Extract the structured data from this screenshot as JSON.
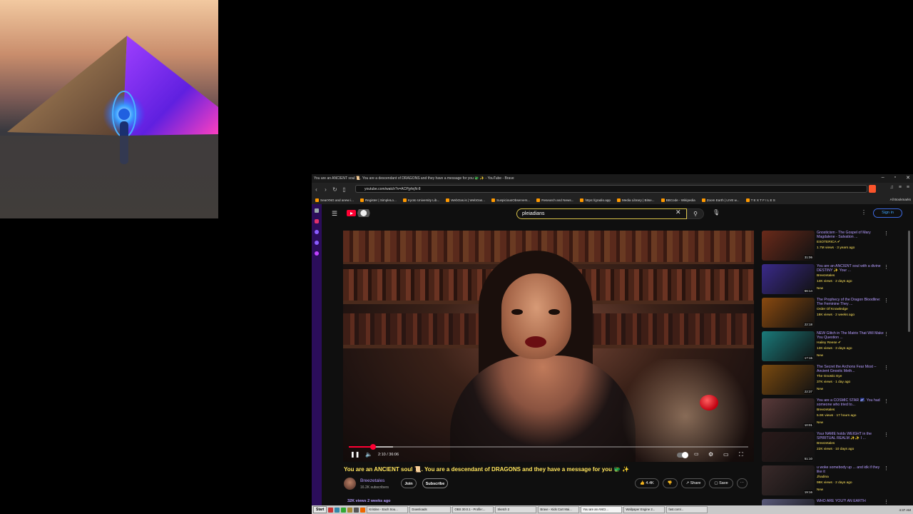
{
  "browser": {
    "window_title": "You are an ANCIENT soul 📜. You are a descendant of DRAGONS and they have a message for you 🐲 ✨ - YouTube - Brave",
    "url": "youtube.com/watch?v=ACPjyfejN-8",
    "bookmarks": [
      "SearXNG and anew i...",
      "Register | SimpleLo...",
      "Kyoto University Lib...",
      "WebOas.is | WebOas...",
      "SuspiciousObservers...",
      "Research and News...",
      "https://gradio.app",
      "Media Library | Bitse...",
      "BBCode - Wikipedia",
      "Zoom Earth | LIVE w...",
      "T E X T F I L E S"
    ],
    "bookmarks_right": "All Bookmarks"
  },
  "youtube": {
    "search_value": "pleiadians",
    "signin_label": "Sign in",
    "video": {
      "title": "You are an ANCIENT soul 📜. You are a descendant of DRAGONS and they have a message for you 🐲 ✨",
      "time": "2:10 / 36:06",
      "progress_fraction": 0.06,
      "buffered_fraction": 0.11,
      "channel": "Breezetales",
      "subscribers": "16.2K subscribers",
      "join_label": "Join",
      "subscribe_label": "Subscribe",
      "likes": "4.4K",
      "share_label": "Share",
      "save_label": "Save",
      "views_line": "32K views  2 weeks ago"
    },
    "recommendations": [
      {
        "title": "Gnosticism - The Gospel of Mary Magdalene - Salvation ...",
        "channel": "ESOTERICA ✔",
        "meta": "1.7M views · 3 years ago",
        "new": "",
        "duration": "31:06",
        "thumb_color": "#6a2a1a"
      },
      {
        "title": "You are an ANCIENT soul with a divine DESTINY ✨ Your ...",
        "channel": "Breezetales",
        "meta": "14K views · 2 days ago",
        "new": "New",
        "duration": "56:14",
        "thumb_color": "#3a2a8a"
      },
      {
        "title": "The Prophecy of the Dragon Bloodline: The Feminine They ...",
        "channel": "Order Of Knowledge",
        "meta": "18K views · 2 weeks ago",
        "new": "",
        "duration": "22:18",
        "thumb_color": "#8a4a10"
      },
      {
        "title": "NEW Glitch in The Matrix That Will Make You Question ...",
        "channel": "Hailey Reese ✔",
        "meta": "13K views · 3 days ago",
        "new": "New",
        "duration": "17:15",
        "thumb_color": "#1a7a7a"
      },
      {
        "title": "The Secret the Archons Fear Most – Ancient Gnostic Meth...",
        "channel": "The Gnostic Eye",
        "meta": "37K views · 1 day ago",
        "new": "New",
        "duration": "22:37",
        "thumb_color": "#7a4a10"
      },
      {
        "title": "You are a COSMIC STAR 🌌. You had someone who tried to...",
        "channel": "Breezetales",
        "meta": "5.9K views · 17 hours ago",
        "new": "New",
        "duration": "10:01",
        "thumb_color": "#5a3a3a"
      },
      {
        "title": "Your NAME holds WEIGHT in the SPIRITUAL REALM ✨✨ I ...",
        "channel": "Breezetales",
        "meta": "22K views · 10 days ago",
        "new": "",
        "duration": "51:10",
        "thumb_color": "#2a1a1a"
      },
      {
        "title": "u woke somebody up ... and idk if they like it",
        "channel": "Jhadina",
        "meta": "98K views · 2 days ago",
        "new": "New",
        "duration": "19:16",
        "thumb_color": "#3a2a2a"
      },
      {
        "title": "WHO ARE YOU?! AN EARTH",
        "channel": "",
        "meta": "",
        "new": "",
        "duration": "",
        "thumb_color": "#5a5a7a"
      }
    ]
  },
  "taskbar": {
    "start_label": "Start",
    "items": [
      "Kristine - Each Sou...",
      "Downloads",
      "OBS 30.0.1 - Profile:...",
      "Sketch 2",
      "Brave - Kids Cart Mai...",
      "You are an ANCI...",
      "Wallpaper Engine 2...",
      "fast.com/..."
    ],
    "active_index": 5,
    "clock": "4:37 AM"
  },
  "colors": {
    "accent_yellow": "#ffe45c",
    "link_purple": "#b59cff",
    "rail_purple": "#2b0d5a",
    "youtube_red": "#ff0033"
  }
}
